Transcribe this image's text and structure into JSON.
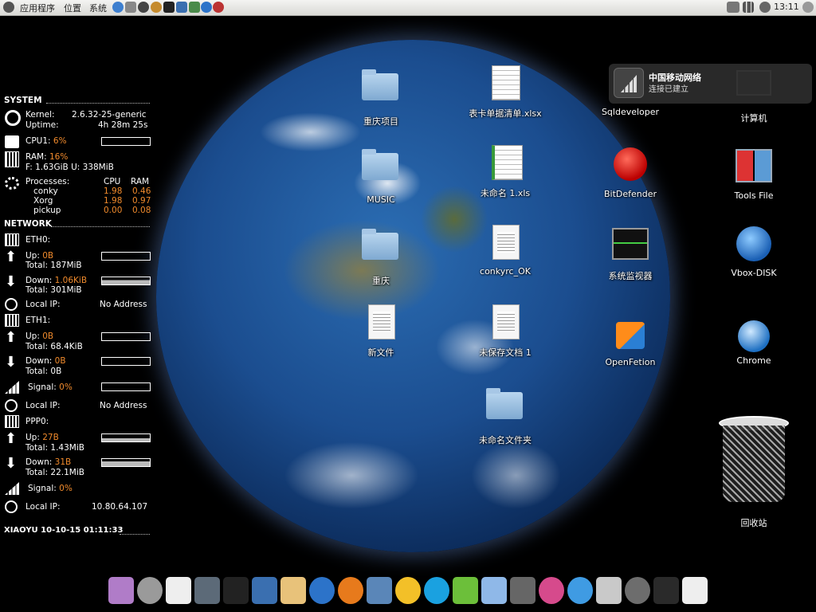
{
  "top_panel": {
    "menus": [
      "应用程序",
      "位置",
      "系统"
    ],
    "clock": "13:11"
  },
  "conky": {
    "system": {
      "title": "SYSTEM",
      "kernel_label": "Kernel:",
      "kernel": "2.6.32-25-generic",
      "uptime_label": "Uptime:",
      "uptime": "4h 28m 25s",
      "cpu_label": "CPU1:",
      "cpu": "6%",
      "ram_label": "RAM:",
      "ram": "16%",
      "ram_detail": "F: 1.63GiB U: 338MiB",
      "processes_label": "Processes:",
      "col_cpu": "CPU",
      "col_ram": "RAM",
      "processes": [
        {
          "name": "conky",
          "cpu": "1.98",
          "ram": "0.46"
        },
        {
          "name": "Xorg",
          "cpu": "1.98",
          "ram": "0.97"
        },
        {
          "name": "pickup",
          "cpu": "0.00",
          "ram": "0.08"
        }
      ]
    },
    "network": {
      "title": "NETWORK",
      "eth0": {
        "name": "ETH0:",
        "up_label": "Up:",
        "up": "0B",
        "up_total": "Total: 187MiB",
        "down_label": "Down:",
        "down": "1.06KiB",
        "down_total": "Total: 301MiB",
        "ip_label": "Local IP:",
        "ip": "No Address"
      },
      "eth1": {
        "name": "ETH1:",
        "up_label": "Up:",
        "up": "0B",
        "up_total": "Total: 68.4KiB",
        "down_label": "Down:",
        "down": "0B",
        "down_total": "Total: 0B",
        "signal_label": "Signal:",
        "signal": "0%",
        "ip_label": "Local IP:",
        "ip": "No Address"
      },
      "ppp0": {
        "name": "PPP0:",
        "up_label": "Up:",
        "up": "27B",
        "up_total": "Total: 1.43MiB",
        "down_label": "Down:",
        "down": "31B",
        "down_total": "Total: 22.1MiB",
        "signal_label": "Signal:",
        "signal": "0%",
        "ip_label": "Local IP:",
        "ip": "10.80.64.107"
      }
    },
    "footer": "XIAOYU 10-10-15  01:11:33"
  },
  "desktop": {
    "icons": [
      {
        "label": "重庆项目",
        "kind": "folder"
      },
      {
        "label": "表卡单据清单.xlsx",
        "kind": "sheet"
      },
      {
        "label": "Sqldeveloper",
        "kind": "app"
      },
      {
        "label": "计算机",
        "kind": "computer"
      },
      {
        "label": "MUSIC",
        "kind": "folder"
      },
      {
        "label": "未命名 1.xls",
        "kind": "sheet"
      },
      {
        "label": "BitDefender",
        "kind": "app"
      },
      {
        "label": "Tools File",
        "kind": "app"
      },
      {
        "label": "重庆",
        "kind": "folder"
      },
      {
        "label": "conkyrc_OK",
        "kind": "doc"
      },
      {
        "label": "系统监视器",
        "kind": "app"
      },
      {
        "label": "Vbox-DISK",
        "kind": "app"
      },
      {
        "label": "新文件",
        "kind": "doc"
      },
      {
        "label": "未保存文档 1",
        "kind": "doc"
      },
      {
        "label": "OpenFetion",
        "kind": "app"
      },
      {
        "label": "Chrome",
        "kind": "app"
      },
      {
        "label": "未命名文件夹",
        "kind": "folder"
      },
      {
        "label": "回收站",
        "kind": "trash"
      }
    ]
  },
  "notification": {
    "title": "中国移动网络",
    "body": "连接已建立"
  },
  "dock": {
    "items": [
      "photo-icon",
      "power-icon",
      "footprint-icon",
      "monitor-icon",
      "terminal-icon",
      "virtualbox-icon",
      "stamp-icon",
      "globe-icon",
      "firefox-icon",
      "mail-icon",
      "qq-icon",
      "skype-icon",
      "bird-icon",
      "feet-icon",
      "laptop-icon",
      "music-icon",
      "itunes-icon",
      "bank-icon",
      "search-icon",
      "notebook-icon",
      "feather-icon"
    ],
    "colors": [
      "#b07cc8",
      "#9a9a9a",
      "#eeeeee",
      "#5c6a78",
      "#222222",
      "#3a6fb0",
      "#e8c27a",
      "#2c73c9",
      "#e77a1c",
      "#5a86b8",
      "#f3c028",
      "#1aa1e0",
      "#6cbf3a",
      "#8fb8e8",
      "#666666",
      "#d64a8c",
      "#3f9be3",
      "#c9c9c9",
      "#6d6d6d",
      "#2a2a2a",
      "#eeeeee"
    ]
  }
}
